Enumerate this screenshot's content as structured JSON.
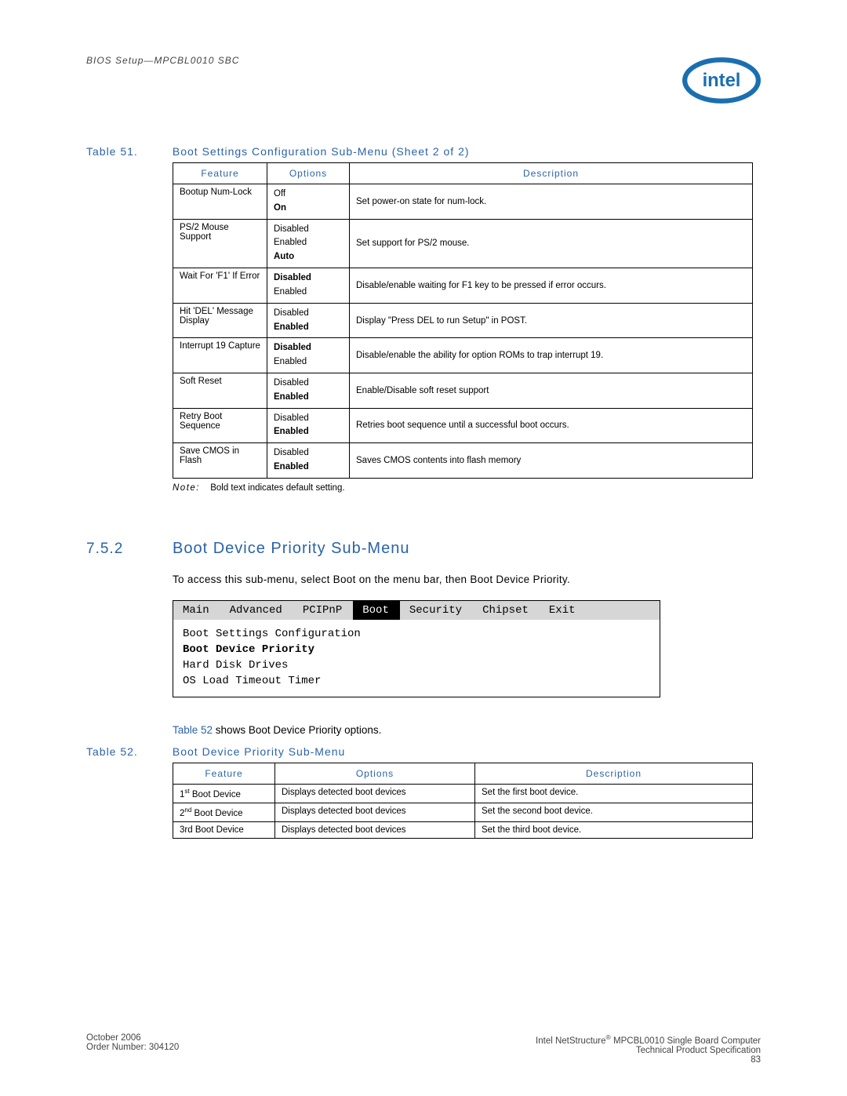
{
  "header": {
    "running": "BIOS Setup—MPCBL0010 SBC",
    "logo_alt": "intel"
  },
  "table51": {
    "caption_num": "Table 51.",
    "caption_txt": "Boot Settings Configuration Sub-Menu (Sheet 2 of 2)",
    "cols": [
      "Feature",
      "Options",
      "Description"
    ],
    "rows": [
      {
        "feature": "Bootup Num-Lock",
        "options": [
          "Off",
          "On"
        ],
        "default": 1,
        "desc": "Set power-on state for num-lock."
      },
      {
        "feature": "PS/2 Mouse Support",
        "options": [
          "Disabled",
          "Enabled",
          "Auto"
        ],
        "default": 2,
        "desc": "Set support for PS/2 mouse."
      },
      {
        "feature": "Wait For 'F1' If Error",
        "options": [
          "Disabled",
          "Enabled"
        ],
        "default": 0,
        "desc": "Disable/enable waiting for F1 key to be pressed if error occurs."
      },
      {
        "feature": "Hit 'DEL' Message Display",
        "options": [
          "Disabled",
          "Enabled"
        ],
        "default": 1,
        "desc": "Display \"Press DEL to run Setup\" in POST."
      },
      {
        "feature": "Interrupt 19 Capture",
        "options": [
          "Disabled",
          "Enabled"
        ],
        "default": 0,
        "desc": "Disable/enable the ability for option ROMs to trap interrupt 19."
      },
      {
        "feature": "Soft Reset",
        "options": [
          "Disabled",
          "Enabled"
        ],
        "default": 1,
        "desc": "Enable/Disable soft reset support"
      },
      {
        "feature": "Retry Boot Sequence",
        "options": [
          "Disabled",
          "Enabled"
        ],
        "default": 1,
        "desc": "Retries boot sequence until a successful boot occurs."
      },
      {
        "feature": "Save CMOS in Flash",
        "options": [
          "Disabled",
          "Enabled"
        ],
        "default": 1,
        "desc": "Saves CMOS contents into flash memory"
      }
    ],
    "note_label": "Note:",
    "note_text": "Bold text indicates default setting."
  },
  "section": {
    "num": "7.5.2",
    "title": "Boot Device Priority Sub-Menu",
    "intro": "To access this sub-menu, select Boot on the menu bar, then Boot Device Priority."
  },
  "bios": {
    "tabs": [
      "Main",
      "Advanced",
      "PCIPnP",
      "Boot",
      "Security",
      "Chipset",
      "Exit"
    ],
    "selected": "Boot",
    "items": [
      "Boot Settings Configuration",
      "Boot Device Priority",
      "Hard Disk Drives",
      "OS Load Timeout Timer"
    ],
    "highlight": "Boot Device Priority"
  },
  "ref": {
    "link": "Table 52",
    "tail": " shows Boot Device Priority options."
  },
  "table52": {
    "caption_num": "Table 52.",
    "caption_txt": "Boot Device Priority Sub-Menu",
    "cols": [
      "Feature",
      "Options",
      "Description"
    ],
    "rows": [
      {
        "feature_html": "1<sup>st</sup> Boot Device",
        "options": "Displays detected boot devices",
        "desc": "Set the first boot device."
      },
      {
        "feature_html": "2<sup>nd</sup> Boot Device",
        "options": "Displays detected boot devices",
        "desc": "Set the second boot device."
      },
      {
        "feature_html": "3rd Boot Device",
        "options": "Displays detected boot devices",
        "desc": "Set the third boot device."
      }
    ]
  },
  "footer": {
    "left1": "October 2006",
    "left2": "Order Number: 304120",
    "right1_pre": "Intel NetStructure",
    "right1_post": " MPCBL0010 Single Board Computer",
    "right2": "Technical Product Specification",
    "right3": "83"
  }
}
